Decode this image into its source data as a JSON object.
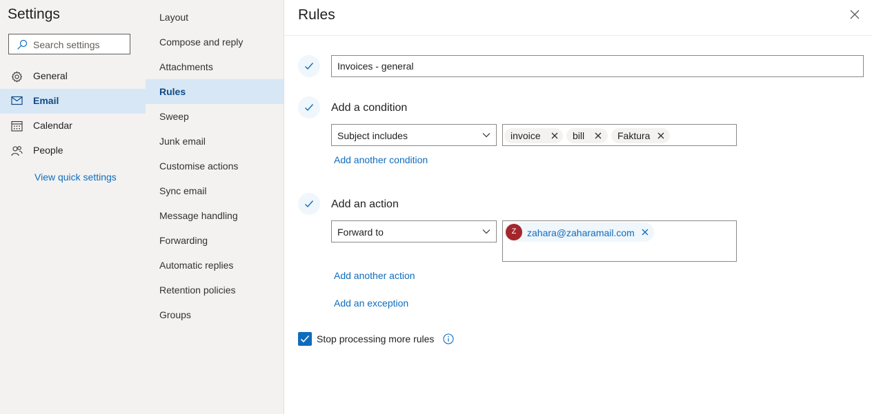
{
  "settings": {
    "title": "Settings",
    "search_placeholder": "Search settings",
    "nav": [
      {
        "label": "General",
        "icon": "gear-icon"
      },
      {
        "label": "Email",
        "icon": "mail-icon"
      },
      {
        "label": "Calendar",
        "icon": "calendar-icon"
      },
      {
        "label": "People",
        "icon": "people-icon"
      }
    ],
    "active_nav": "Email",
    "quick_link": "View quick settings"
  },
  "email_menu": {
    "items": [
      "Layout",
      "Compose and reply",
      "Attachments",
      "Rules",
      "Sweep",
      "Junk email",
      "Customise actions",
      "Sync email",
      "Message handling",
      "Forwarding",
      "Automatic replies",
      "Retention policies",
      "Groups"
    ],
    "active": "Rules"
  },
  "rules": {
    "title": "Rules",
    "rule_name": "Invoices - general",
    "condition": {
      "title": "Add a condition",
      "dropdown": "Subject includes",
      "chips": [
        "invoice",
        "bill",
        "Faktura"
      ],
      "add_link": "Add another condition"
    },
    "action": {
      "title": "Add an action",
      "dropdown": "Forward to",
      "recipient_initial": "Z",
      "recipient_email": "zahara@zaharamail.com",
      "add_link": "Add another action",
      "exception_link": "Add an exception"
    },
    "stop_processing": {
      "label": "Stop processing more rules",
      "checked": true
    }
  },
  "colors": {
    "accent": "#0f6cbd",
    "active_background": "#d8e7f5",
    "avatar": "#a4262c"
  }
}
